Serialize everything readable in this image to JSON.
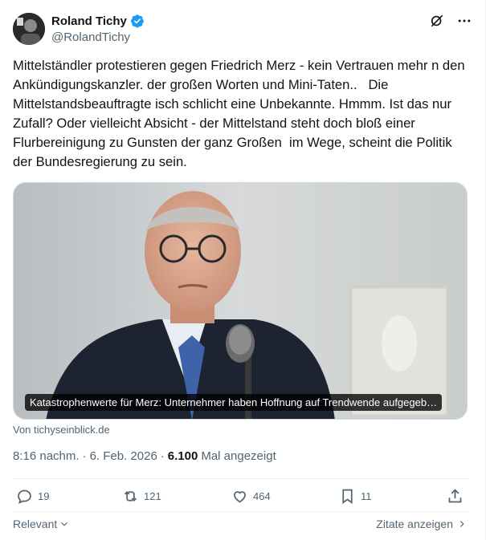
{
  "author": {
    "name": "Roland Tichy",
    "handle": "@RolandTichy",
    "verified_color": "#1d9bf0"
  },
  "header_icons": [
    "grok-icon",
    "more-icon"
  ],
  "tweet": {
    "text": "Mittelständler protestieren gegen Friedrich Merz - kein Vertrauen mehr n den Ankündigungskanzler. der großen Worten und Mini-Taten..   Die Mittelstandsbeauftragte isch schlicht eine Unbekannte. Hmmm. Ist das nur Zufall? Oder vielleicht Absicht - der Mittelstand steht doch bloß einer Flurbereinigung zu Gunsten der ganz Großen  im Wege, scheint die Politik der Bundesregierung zu sein."
  },
  "card": {
    "headline": "Katastrophenwerte für Merz: Unternehmer haben Hoffnung auf Trendwende aufgegeb…",
    "source": "Von tichyseinblick.de"
  },
  "meta": {
    "time": "8:16 nachm.",
    "sep1": "·",
    "date": "6. Feb. 2026",
    "sep2": "·",
    "views": "6.100",
    "views_label": "Mal angezeigt"
  },
  "actions": {
    "replies": "19",
    "reposts": "121",
    "likes": "464",
    "bookmarks": "11"
  },
  "footer": {
    "sort_label": "Relevant",
    "quotes_label": "Zitate anzeigen"
  }
}
